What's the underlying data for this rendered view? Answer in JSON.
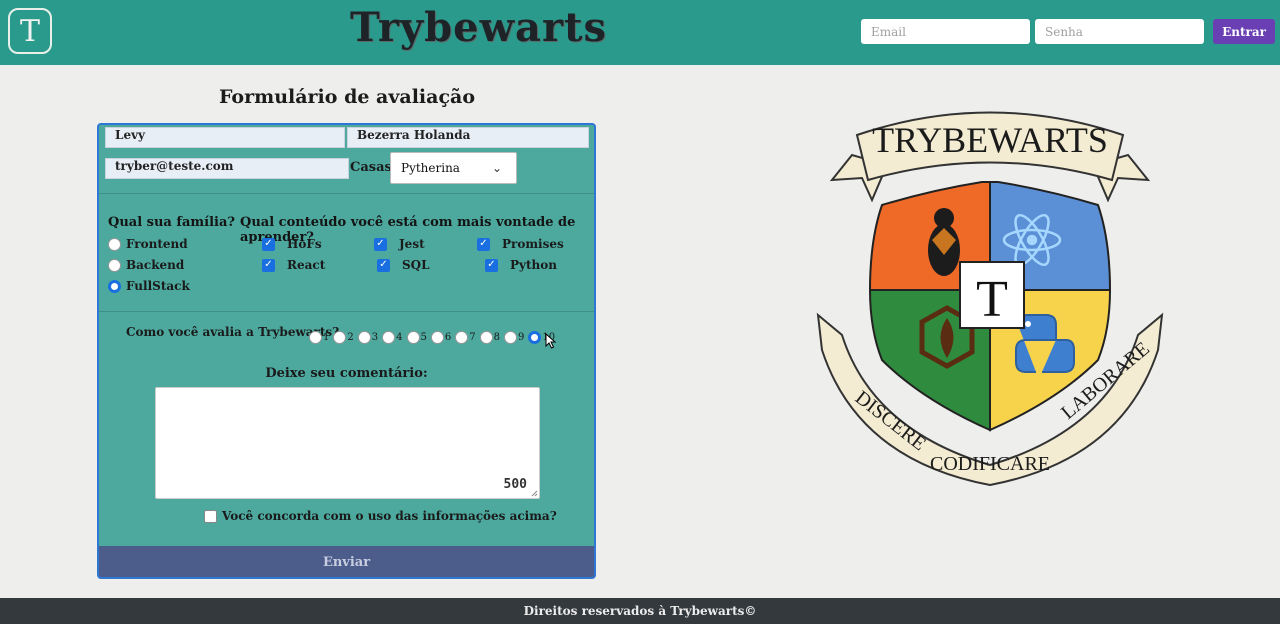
{
  "header": {
    "logo_letter": "T",
    "title": "Trybewarts",
    "email_placeholder": "Email",
    "password_placeholder": "Senha",
    "login_button": "Entrar"
  },
  "form": {
    "title": "Formulário de avaliação",
    "first_name": "Levy",
    "last_name": "Bezerra Holanda",
    "email": "tryber@teste.com",
    "house_label": "Casas",
    "house_selected": "Pytherina",
    "family_heading": "Qual sua família?",
    "families": [
      {
        "label": "Frontend",
        "checked": false
      },
      {
        "label": "Backend",
        "checked": false
      },
      {
        "label": "FullStack",
        "checked": true
      }
    ],
    "content_heading": "Qual conteúdo você está com mais vontade de aprender?",
    "contents": [
      {
        "label": "HoFs",
        "checked": true
      },
      {
        "label": "Jest",
        "checked": true
      },
      {
        "label": "Promises",
        "checked": true
      },
      {
        "label": "React",
        "checked": true
      },
      {
        "label": "SQL",
        "checked": true
      },
      {
        "label": "Python",
        "checked": true
      }
    ],
    "rating_label": "Como você avalia a Trybewarts?",
    "ratings": [
      "1",
      "2",
      "3",
      "4",
      "5",
      "6",
      "7",
      "8",
      "9",
      "10"
    ],
    "rating_selected": "10",
    "comment_label": "Deixe seu comentário:",
    "char_counter": "500",
    "agreement_label": "Você concorda com o uso das informações acima?",
    "submit_button": "Enviar"
  },
  "crest": {
    "banner_top": "TRYBEWARTS",
    "center_letter": "T",
    "motto_left": "DISCERE",
    "motto_bottom": "CODIFICARE",
    "motto_right": "LABORARE"
  },
  "footer": {
    "text": "Direitos reservados à Trybewarts©"
  },
  "colors": {
    "header_bg": "#2a9a8d",
    "form_bg": "#4da89e",
    "accent_blue": "#1a6fe0",
    "login_button": "#6a3fb3",
    "submit_bg": "#4c5d8c",
    "footer_bg": "#34393d"
  }
}
